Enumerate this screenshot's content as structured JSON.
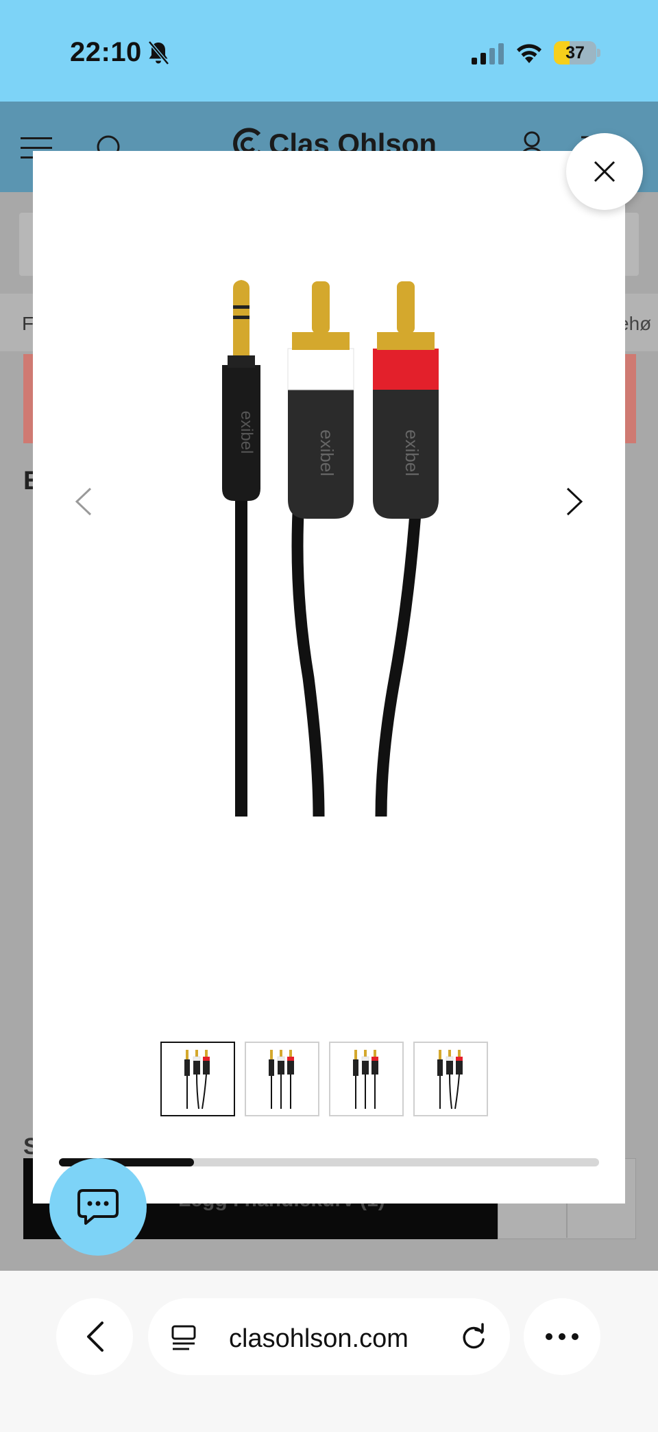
{
  "status_bar": {
    "time": "22:10",
    "battery_level": "37",
    "battery_fraction": 0.37
  },
  "site": {
    "logo_text": "Clas Ohlson",
    "nav_left_fragment": "F",
    "nav_right_fragment": "ehø",
    "product_title_fragment": "E",
    "section_fragment": "S",
    "cart_button_label": "Legg i handlekurv (1)"
  },
  "gallery": {
    "thumbnail_count": 4,
    "active_thumbnail": 1,
    "scroll_progress": 0.25
  },
  "browser": {
    "url": "clasohlson.com"
  },
  "colors": {
    "status_bar_bg": "#7dd3f7",
    "chat_button_bg": "#7dd3f7",
    "battery_fill": "#f7cf1b",
    "rca_red": "#e3202b"
  },
  "icons": [
    "bell-slash-icon",
    "cellular-signal-icon",
    "wifi-icon",
    "battery-icon",
    "menu-icon",
    "search-icon",
    "user-icon",
    "cart-icon",
    "close-icon",
    "chevron-left-icon",
    "chevron-right-icon",
    "chat-icon",
    "back-icon",
    "reader-icon",
    "reload-icon",
    "more-icon"
  ]
}
